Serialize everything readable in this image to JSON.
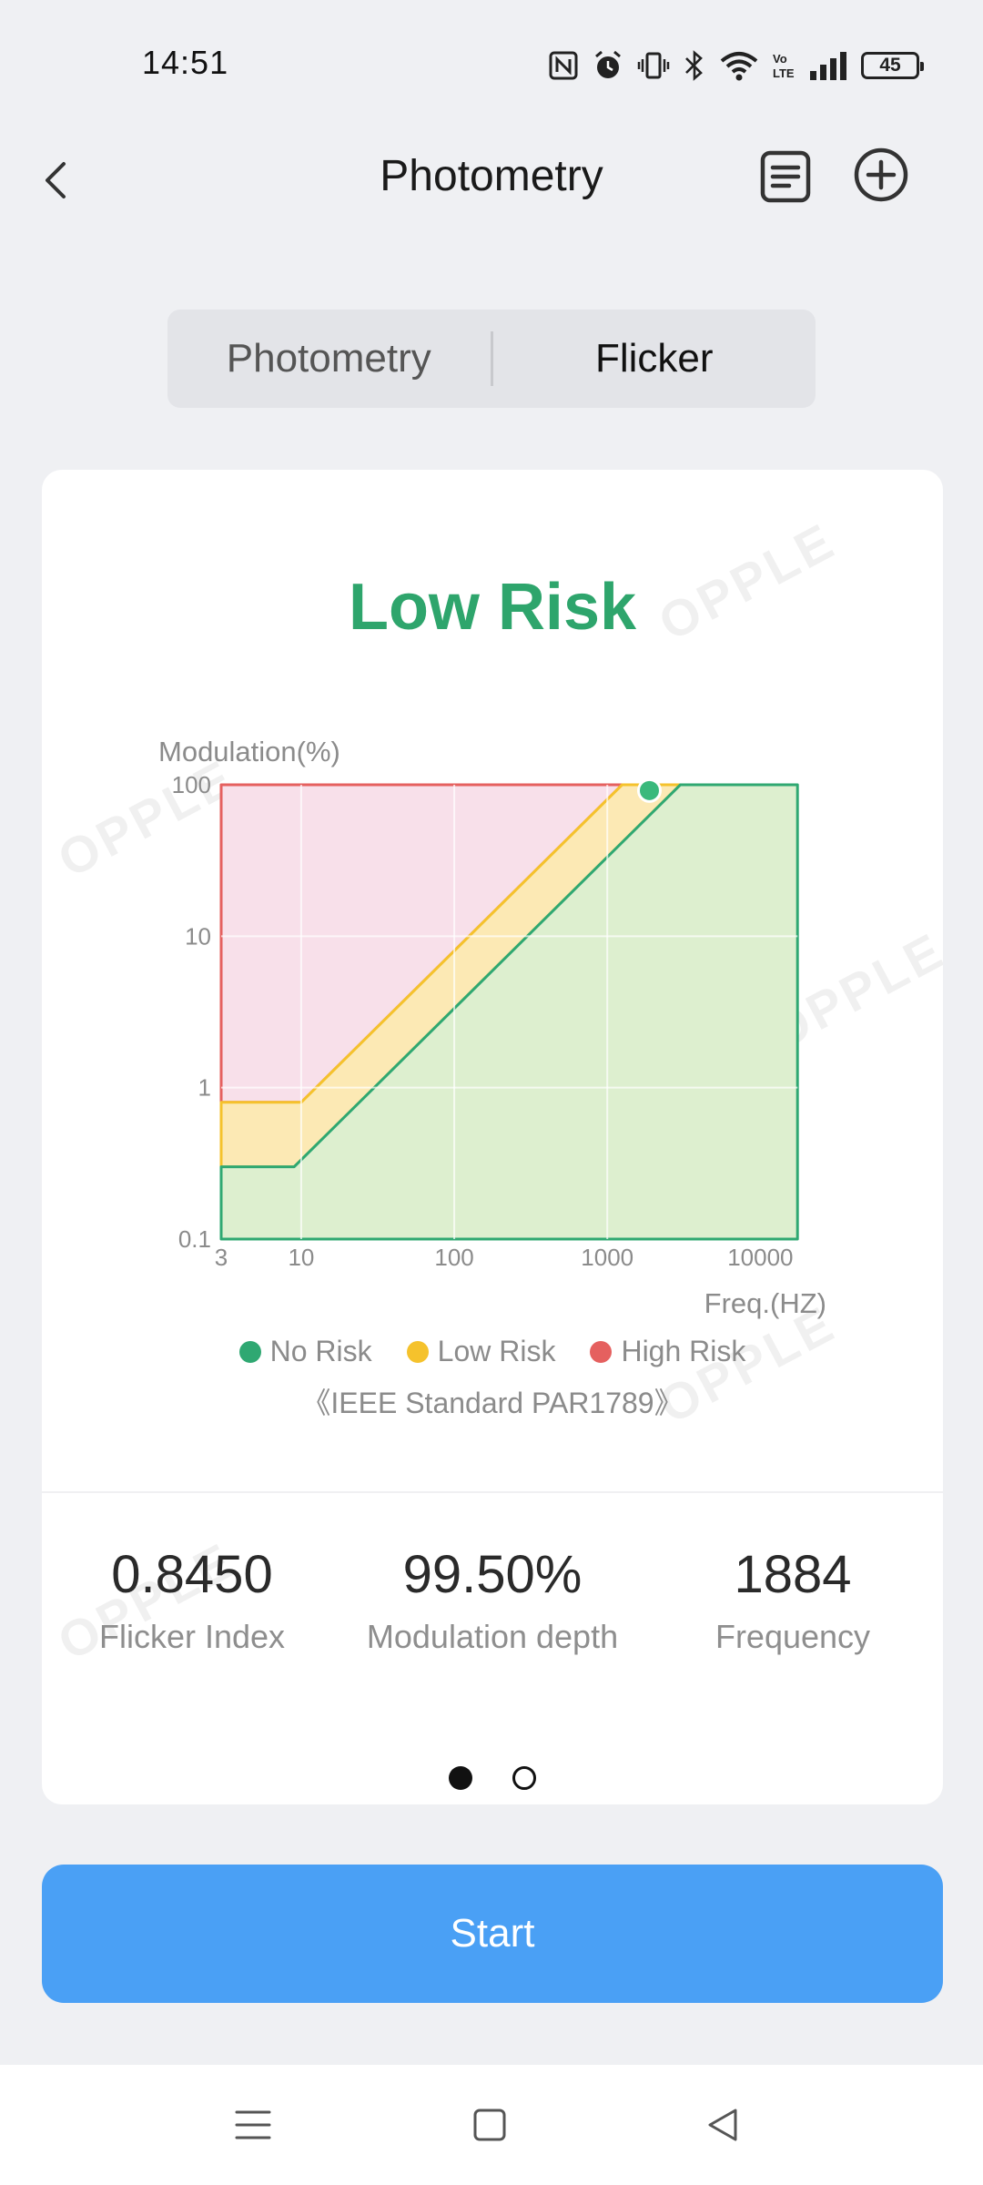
{
  "status": {
    "time": "14:51",
    "battery": "45"
  },
  "header": {
    "title": "Photometry"
  },
  "tabs": [
    {
      "label": "Photometry",
      "active": false
    },
    {
      "label": "Flicker",
      "active": true
    }
  ],
  "risk_level": "Low Risk",
  "watermark_text": "OPPLE",
  "chart_data": {
    "type": "area",
    "ylabel": "Modulation(%)",
    "xlabel": "Freq.(HZ)",
    "x_scale": "log",
    "y_scale": "log",
    "xlim": [
      3,
      20000
    ],
    "ylim": [
      0.1,
      100
    ],
    "x_ticks": [
      "3",
      "10",
      "100",
      "1000",
      "10000"
    ],
    "y_ticks": [
      "0.1",
      "1",
      "10",
      "100"
    ],
    "series": [
      {
        "name": "No Risk",
        "color": "#2fa872",
        "fill": "#ddefcf",
        "boundary": [
          [
            3,
            0.3
          ],
          [
            9,
            0.3
          ],
          [
            3000,
            100
          ]
        ]
      },
      {
        "name": "Low Risk",
        "color": "#f5c22c",
        "fill": "#fce9b4",
        "boundary": [
          [
            3,
            0.8
          ],
          [
            10,
            0.8
          ],
          [
            1250,
            100
          ]
        ]
      },
      {
        "name": "High Risk",
        "color": "#e5605f",
        "fill": "#f8e0ea"
      }
    ],
    "measured_point": {
      "x": 1884,
      "y": 99.5,
      "color": "#3ab97c"
    },
    "legend_position": "bottom",
    "grid": true
  },
  "standard_note": "《IEEE Standard PAR1789》",
  "metrics": [
    {
      "value": "0.8450",
      "label": "Flicker Index"
    },
    {
      "value": "99.50%",
      "label": "Modulation depth"
    },
    {
      "value": "1884",
      "label": "Frequency"
    }
  ],
  "pager": {
    "pages": 2,
    "current": 1
  },
  "start_button": {
    "label": "Start"
  },
  "colors": {
    "accent": "#4aa0f5",
    "risk_green": "#2ea56c"
  }
}
